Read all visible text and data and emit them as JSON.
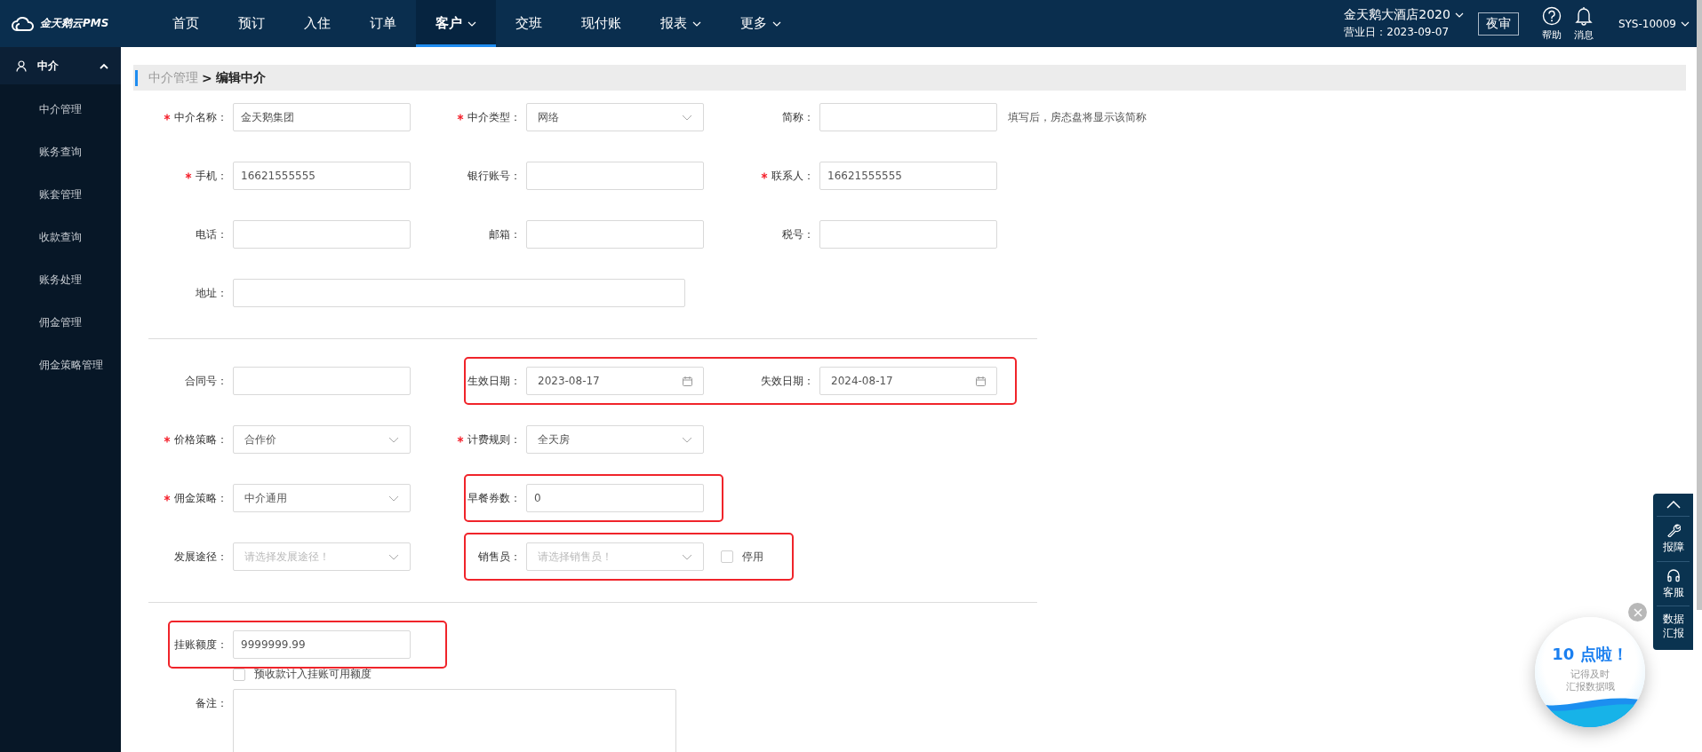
{
  "header": {
    "logo": "金天鹅云PMS",
    "nav": [
      {
        "label": "首页",
        "selected": false,
        "dropdown": false
      },
      {
        "label": "预订",
        "selected": false,
        "dropdown": false
      },
      {
        "label": "入住",
        "selected": false,
        "dropdown": false
      },
      {
        "label": "订单",
        "selected": false,
        "dropdown": false
      },
      {
        "label": "客户",
        "selected": true,
        "dropdown": true
      },
      {
        "label": "交班",
        "selected": false,
        "dropdown": false
      },
      {
        "label": "现付账",
        "selected": false,
        "dropdown": false
      },
      {
        "label": "报表",
        "selected": false,
        "dropdown": true
      },
      {
        "label": "更多",
        "selected": false,
        "dropdown": true
      }
    ],
    "hotel": {
      "name": "金天鹅大酒店2020",
      "business_day": "营业日：2023-09-07"
    },
    "night_audit": "夜审",
    "help": "帮助",
    "messages": "消息",
    "user": "SYS-10009"
  },
  "sidebar": {
    "section": {
      "label": "中介",
      "expanded": true
    },
    "items": [
      {
        "label": "中介管理",
        "selected": false
      },
      {
        "label": "账务查询",
        "selected": false
      },
      {
        "label": "账套管理",
        "selected": false
      },
      {
        "label": "收款查询",
        "selected": false
      },
      {
        "label": "账务处理",
        "selected": false
      },
      {
        "label": "佣金管理",
        "selected": false
      },
      {
        "label": "佣金策略管理",
        "selected": false
      }
    ]
  },
  "breadcrumb": {
    "parent": "中介管理",
    "separator": ">",
    "current": "编辑中介"
  },
  "form": {
    "sections": [
      {
        "rows": [
          [
            {
              "kind": "input",
              "label": "中介名称：",
              "required": true,
              "value": "金天鹅集团",
              "highlighted": false
            },
            {
              "kind": "select",
              "label": "中介类型：",
              "required": true,
              "value": "网络",
              "highlighted": false
            },
            {
              "kind": "input",
              "label": "简称：",
              "required": false,
              "hint": "填写后，房态盘将显示该简称",
              "highlighted": false
            }
          ],
          [
            {
              "kind": "input",
              "label": "手机：",
              "required": true,
              "value": "16621555555",
              "highlighted": false
            },
            {
              "kind": "input",
              "label": "银行账号：",
              "required": false,
              "highlighted": false
            },
            {
              "kind": "input",
              "label": "联系人：",
              "required": true,
              "value": "16621555555",
              "highlighted": false
            }
          ],
          [
            {
              "kind": "input",
              "label": "电话：",
              "required": false,
              "highlighted": false
            },
            {
              "kind": "input",
              "label": "邮箱：",
              "required": false,
              "highlighted": false
            },
            {
              "kind": "input",
              "label": "税号：",
              "required": false,
              "highlighted": false
            }
          ],
          [
            {
              "kind": "long_input",
              "label": "地址：",
              "required": false,
              "highlighted": false
            }
          ]
        ]
      },
      {
        "rows": [
          [
            {
              "kind": "input",
              "label": "合同号：",
              "required": false,
              "highlighted": false
            },
            {
              "kind": "date",
              "label": "生效日期：",
              "required": false,
              "value": "2023-08-17",
              "highlighted": true
            },
            {
              "kind": "date",
              "label": "失效日期：",
              "required": false,
              "value": "2024-08-17",
              "highlighted": true
            }
          ],
          [
            {
              "kind": "select",
              "label": "价格策略：",
              "required": true,
              "value": "合作价",
              "highlighted": false
            },
            {
              "kind": "select",
              "label": "计费规则：",
              "required": true,
              "value": "全天房",
              "highlighted": false
            }
          ],
          [
            {
              "kind": "select",
              "label": "佣金策略：",
              "required": true,
              "value": "中介通用",
              "highlighted": false
            },
            {
              "kind": "input",
              "label": "早餐券数：",
              "required": false,
              "value": "0",
              "highlighted": true
            }
          ],
          [
            {
              "kind": "select",
              "label": "发展途径：",
              "required": false,
              "placeholder": "请选择发展途径！",
              "highlighted": false
            },
            {
              "kind": "select",
              "label": "销售员：",
              "required": false,
              "placeholder": "请选择销售员！",
              "highlighted": true
            },
            {
              "kind": "checkbox",
              "label": "停用",
              "checked": false,
              "highlighted": true
            }
          ]
        ]
      },
      {
        "rows": [
          [
            {
              "kind": "input",
              "label": "挂账额度：",
              "required": false,
              "value": "9999999.99",
              "highlighted": true
            }
          ],
          [
            {
              "kind": "checkbox",
              "label": "预收款计入挂账可用额度",
              "checked": false,
              "highlighted": false
            }
          ],
          [
            {
              "kind": "textarea",
              "label": "备注：",
              "required": false,
              "highlighted": false
            }
          ]
        ]
      }
    ]
  },
  "toolbar": [
    {
      "kind": "scroll_top"
    },
    {
      "kind": "wrench",
      "label": "报障"
    },
    {
      "kind": "headset",
      "label": "客服"
    },
    {
      "kind": "text",
      "label": "数据汇报"
    }
  ],
  "reminder": {
    "title": "10 点啦！",
    "lines": [
      "记得及时",
      "汇报数据哦"
    ]
  }
}
